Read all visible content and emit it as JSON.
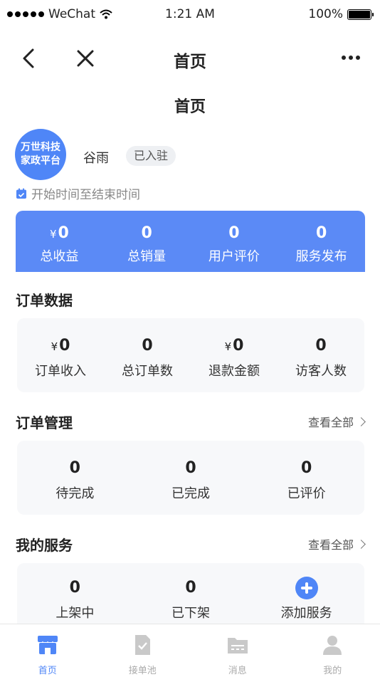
{
  "status": {
    "carrier": "WeChat",
    "time": "1:21 AM",
    "battery": "100%"
  },
  "nav": {
    "title": "首页"
  },
  "page_title": "首页",
  "profile": {
    "logo_line1": "万世科技",
    "logo_line2": "家政平台",
    "name": "谷雨",
    "badge": "已入驻"
  },
  "date_range": "开始时间至结束时间",
  "summary": [
    {
      "currency": "¥",
      "value": "0",
      "label": "总收益"
    },
    {
      "currency": "",
      "value": "0",
      "label": "总销量"
    },
    {
      "currency": "",
      "value": "0",
      "label": "用户评价"
    },
    {
      "currency": "",
      "value": "0",
      "label": "服务发布"
    }
  ],
  "order_data": {
    "title": "订单数据",
    "items": [
      {
        "currency": "¥",
        "value": "0",
        "label": "订单收入"
      },
      {
        "currency": "",
        "value": "0",
        "label": "总订单数"
      },
      {
        "currency": "¥",
        "value": "0",
        "label": "退款金额"
      },
      {
        "currency": "",
        "value": "0",
        "label": "访客人数"
      }
    ]
  },
  "order_mgmt": {
    "title": "订单管理",
    "view_all": "查看全部",
    "items": [
      {
        "value": "0",
        "label": "待完成"
      },
      {
        "value": "0",
        "label": "已完成"
      },
      {
        "value": "0",
        "label": "已评价"
      }
    ]
  },
  "my_services": {
    "title": "我的服务",
    "view_all": "查看全部",
    "items": [
      {
        "value": "0",
        "label": "上架中"
      },
      {
        "value": "0",
        "label": "已下架"
      }
    ],
    "add_label": "添加服务"
  },
  "tabs": [
    {
      "label": "首页",
      "icon": "store-icon"
    },
    {
      "label": "接单池",
      "icon": "order-pool-icon"
    },
    {
      "label": "消息",
      "icon": "message-icon"
    },
    {
      "label": "我的",
      "icon": "user-icon"
    }
  ],
  "colors": {
    "accent": "#4f86f7",
    "card": "#5b8af6",
    "panel_bg": "#f7f8fa"
  }
}
